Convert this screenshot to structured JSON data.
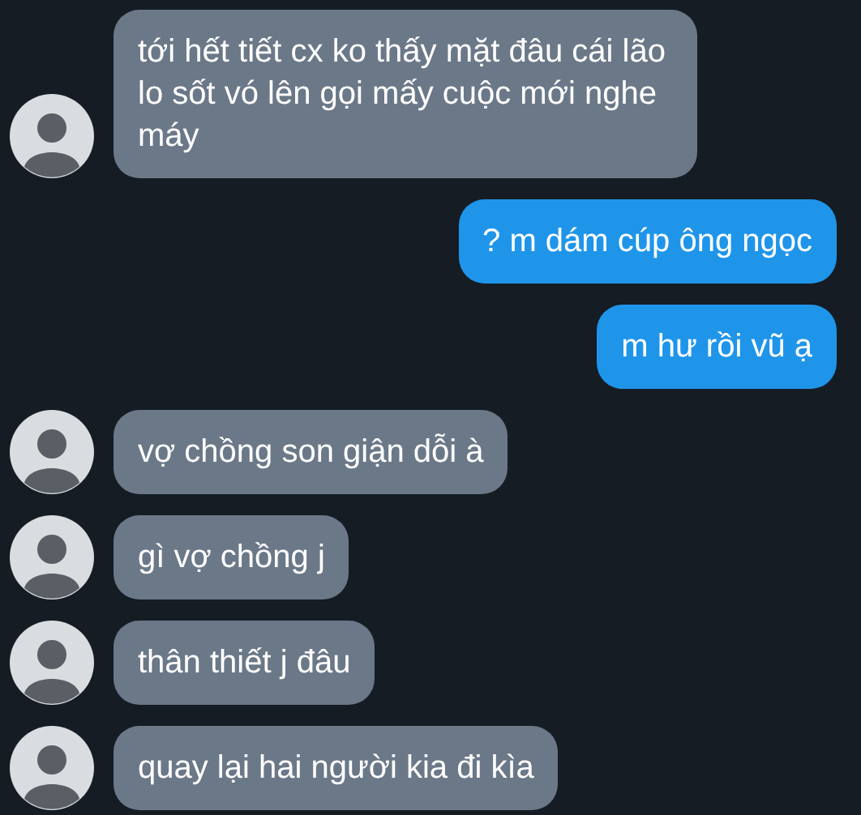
{
  "messages": [
    {
      "kind": "incoming",
      "text": "tới hết tiết cx ko thấy mặt đâu cái lão lo sốt vó lên gọi mấy cuộc mới nghe máy"
    },
    {
      "kind": "outgoing",
      "text": "? m dám cúp ông ngọc"
    },
    {
      "kind": "outgoing",
      "text": "m hư rồi vũ ạ"
    },
    {
      "kind": "incoming",
      "text": "vợ chồng son giận dỗi à"
    },
    {
      "kind": "incoming",
      "text": "gì vợ chồng j"
    },
    {
      "kind": "incoming",
      "text": "thân thiết j đâu"
    },
    {
      "kind": "incoming",
      "text": "quay lại hai người kia đi kìa"
    }
  ]
}
